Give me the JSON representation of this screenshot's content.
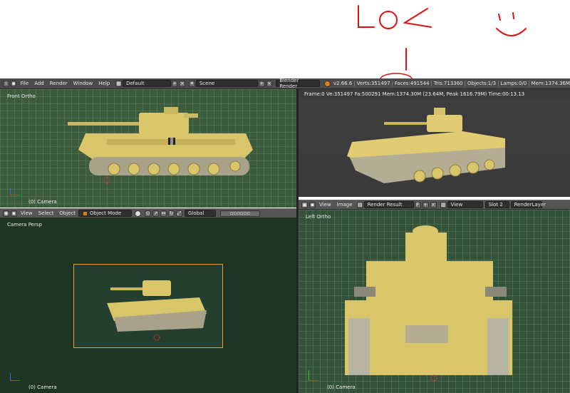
{
  "annotation": {
    "handwritten": "LOL",
    "smiley": ":)"
  },
  "header": {
    "menus": [
      "File",
      "Add",
      "Render",
      "Window",
      "Help"
    ],
    "layout": "Default",
    "scene": "Scene",
    "engine": "Blender Render",
    "version": "v2.66.6",
    "verts": "Verts:351497",
    "faces": "Faces:491544",
    "tris": "Tris:713360",
    "objects": "Objects:1/3",
    "lamps": "Lamps:0/0",
    "mem": "Mem:1374.36M"
  },
  "viewports": {
    "front": {
      "label": "Front Ortho",
      "footer": "(0) Camera"
    },
    "camera": {
      "label": "Camera Persp",
      "footer": "(0) Camera"
    },
    "left": {
      "label": "Left Ortho",
      "footer": "(0) Camera"
    }
  },
  "render": {
    "stats": "Frame:0 Ve:351497 Fa:500291 Mem:1374.30M (23.64M, Peak 1616.79M) Time:00:13.13"
  },
  "view3d_header": {
    "menus": [
      "View",
      "Select",
      "Object"
    ],
    "mode": "Object Mode",
    "orientation": "Global"
  },
  "image_header": {
    "menus": [
      "View",
      "Image"
    ],
    "image": "Render Result",
    "f_label": "F",
    "view": "View",
    "slot": "Slot 2",
    "layer": "RenderLayer"
  },
  "colors": {
    "tank": "#d9c56a",
    "viewport_green": "#3c5a3c",
    "camera_frame": "#e8a020",
    "annotation_red": "#e01010"
  }
}
